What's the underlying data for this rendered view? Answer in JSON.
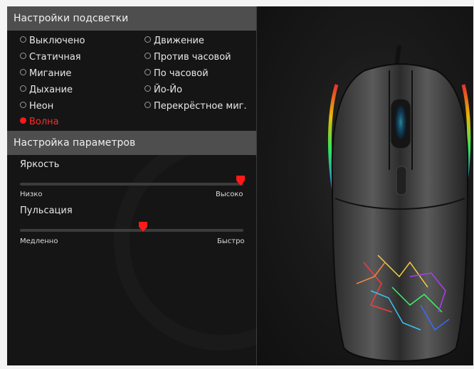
{
  "lighting": {
    "header": "Настройки подсветки",
    "modes_col1": [
      "Выключено",
      "Статичная",
      "Мигание",
      "Дыхание",
      "Неон",
      "Волна"
    ],
    "modes_col2": [
      "Движение",
      "Против часовой",
      "По часовой",
      "Йо-Йо",
      "Перекрёстное миг."
    ],
    "selected": "Волна"
  },
  "params": {
    "header": "Настройка параметров",
    "brightness": {
      "label": "Яркость",
      "min_label": "Низко",
      "max_label": "Высоко",
      "value_fraction": 1.0
    },
    "pulse": {
      "label": "Пульсация",
      "min_label": "Медленно",
      "max_label": "Быстро",
      "value_fraction": 0.55
    }
  },
  "colors": {
    "accent": "#ff1a1a",
    "header_bg": "#4e4e4e",
    "panel_bg": "#151515"
  },
  "icons": {
    "mouse_preview": "gaming-mouse-image"
  }
}
